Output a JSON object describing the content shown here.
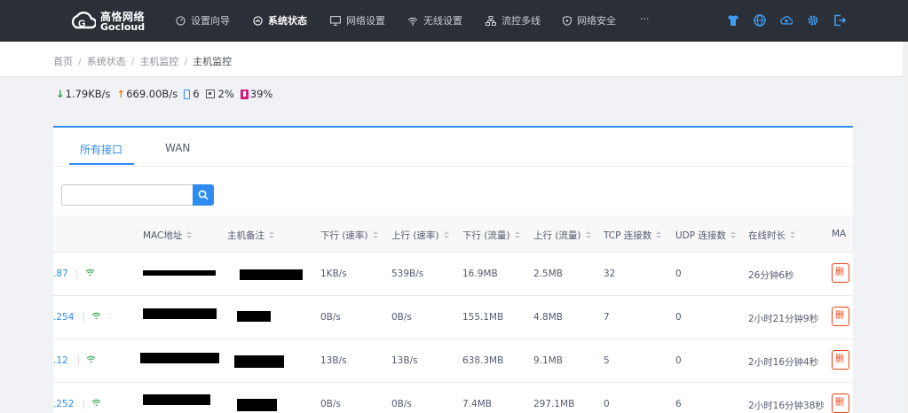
{
  "brand": {
    "name_cn": "高恪网络",
    "name_en": "Gocloud"
  },
  "nav": {
    "items": [
      {
        "label": "设置向导",
        "icon": "gauge-icon"
      },
      {
        "label": "系统状态",
        "icon": "dashboard-icon",
        "active": true
      },
      {
        "label": "网络设置",
        "icon": "monitor-icon"
      },
      {
        "label": "无线设置",
        "icon": "wifi-icon"
      },
      {
        "label": "流控多线",
        "icon": "network-icon"
      },
      {
        "label": "网络安全",
        "icon": "shield-icon"
      }
    ],
    "more": "···",
    "right_icons": [
      "shirt-icon",
      "globe-icon",
      "cloud-upload-icon",
      "gear-icon",
      "logout-icon"
    ]
  },
  "breadcrumb": {
    "items": [
      "首页",
      "系统状态",
      "主机监控",
      "主机监控"
    ]
  },
  "stats": {
    "download": "1.79KB/s",
    "upload": "669.00B/s",
    "devices": "6",
    "cpu": "2%",
    "memory": "39%"
  },
  "tabs": [
    {
      "label": "所有接口",
      "active": true
    },
    {
      "label": "WAN"
    }
  ],
  "search": {
    "placeholder": "",
    "value": ""
  },
  "table": {
    "headers": {
      "mac": "MAC地址",
      "remark": "主机备注",
      "down_rate": "下行 (速率)",
      "up_rate": "上行 (速率)",
      "down_traffic": "下行 (流量)",
      "up_traffic": "上行 (流量)",
      "tcp": "TCP 连接数",
      "udp": "UDP 连接数",
      "online": "在线时长",
      "ma": "MA"
    },
    "rows": [
      {
        "ip": ".87",
        "down_rate": "1KB/s",
        "up_rate": "539B/s",
        "down_traffic": "16.9MB",
        "up_traffic": "2.5MB",
        "tcp": "32",
        "udp": "0",
        "online": "26分钟6秒",
        "action": "删"
      },
      {
        "ip": ".254",
        "down_rate": "0B/s",
        "up_rate": "0B/s",
        "down_traffic": "155.1MB",
        "up_traffic": "4.8MB",
        "tcp": "7",
        "udp": "0",
        "online": "2小时21分钟9秒",
        "action": "删"
      },
      {
        "ip": ".12",
        "down_rate": "13B/s",
        "up_rate": "13B/s",
        "down_traffic": "638.3MB",
        "up_traffic": "9.1MB",
        "tcp": "5",
        "udp": "0",
        "online": "2小时16分钟4秒",
        "action": "删"
      },
      {
        "ip": ".252",
        "down_rate": "0B/s",
        "up_rate": "0B/s",
        "down_traffic": "7.4MB",
        "up_traffic": "297.1MB",
        "tcp": "0",
        "udp": "6",
        "online": "2小时16分钟38秒",
        "action": "删"
      }
    ]
  },
  "colors": {
    "nav_bg": "#2b2f38",
    "accent": "#2e8cf0",
    "download": "#23a042",
    "upload": "#ef7d1a",
    "memory": "#d41c7b",
    "danger": "#ed4014"
  }
}
